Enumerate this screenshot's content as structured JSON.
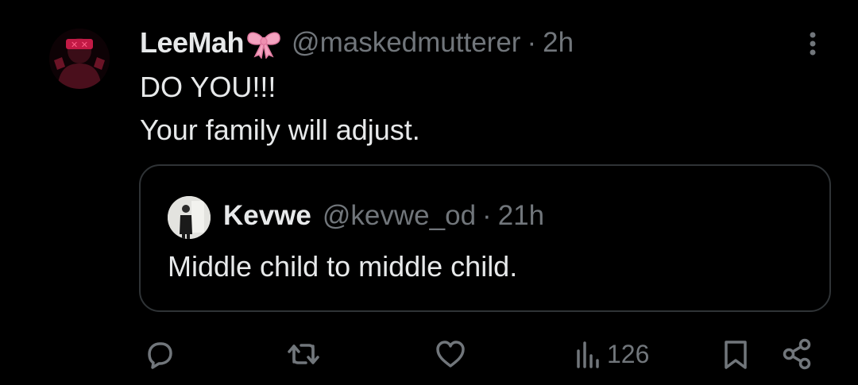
{
  "tweet": {
    "author": {
      "name": "LeeMah",
      "emoji_icon": "ribbon-bow-icon",
      "handle": "@maskedmutterer",
      "separator": "·",
      "time": "2h"
    },
    "text_lines": [
      "DO YOU!!!",
      "Your family will adjust."
    ],
    "quote": {
      "author": {
        "name": "Kevwe",
        "handle": "@kevwe_od",
        "separator": "·",
        "time": "21h"
      },
      "text": "Middle child to middle child."
    },
    "actions": {
      "reply_icon": "speech-bubble-icon",
      "retweet_icon": "retweet-icon",
      "like_icon": "heart-icon",
      "views_icon": "bar-chart-icon",
      "views_count": "126",
      "bookmark_icon": "bookmark-icon",
      "share_icon": "share-icon"
    }
  },
  "colors": {
    "background": "#000000",
    "text": "#e7e9ea",
    "muted": "#71767b",
    "border": "#2f3336",
    "bow": "#f4a3c0"
  }
}
